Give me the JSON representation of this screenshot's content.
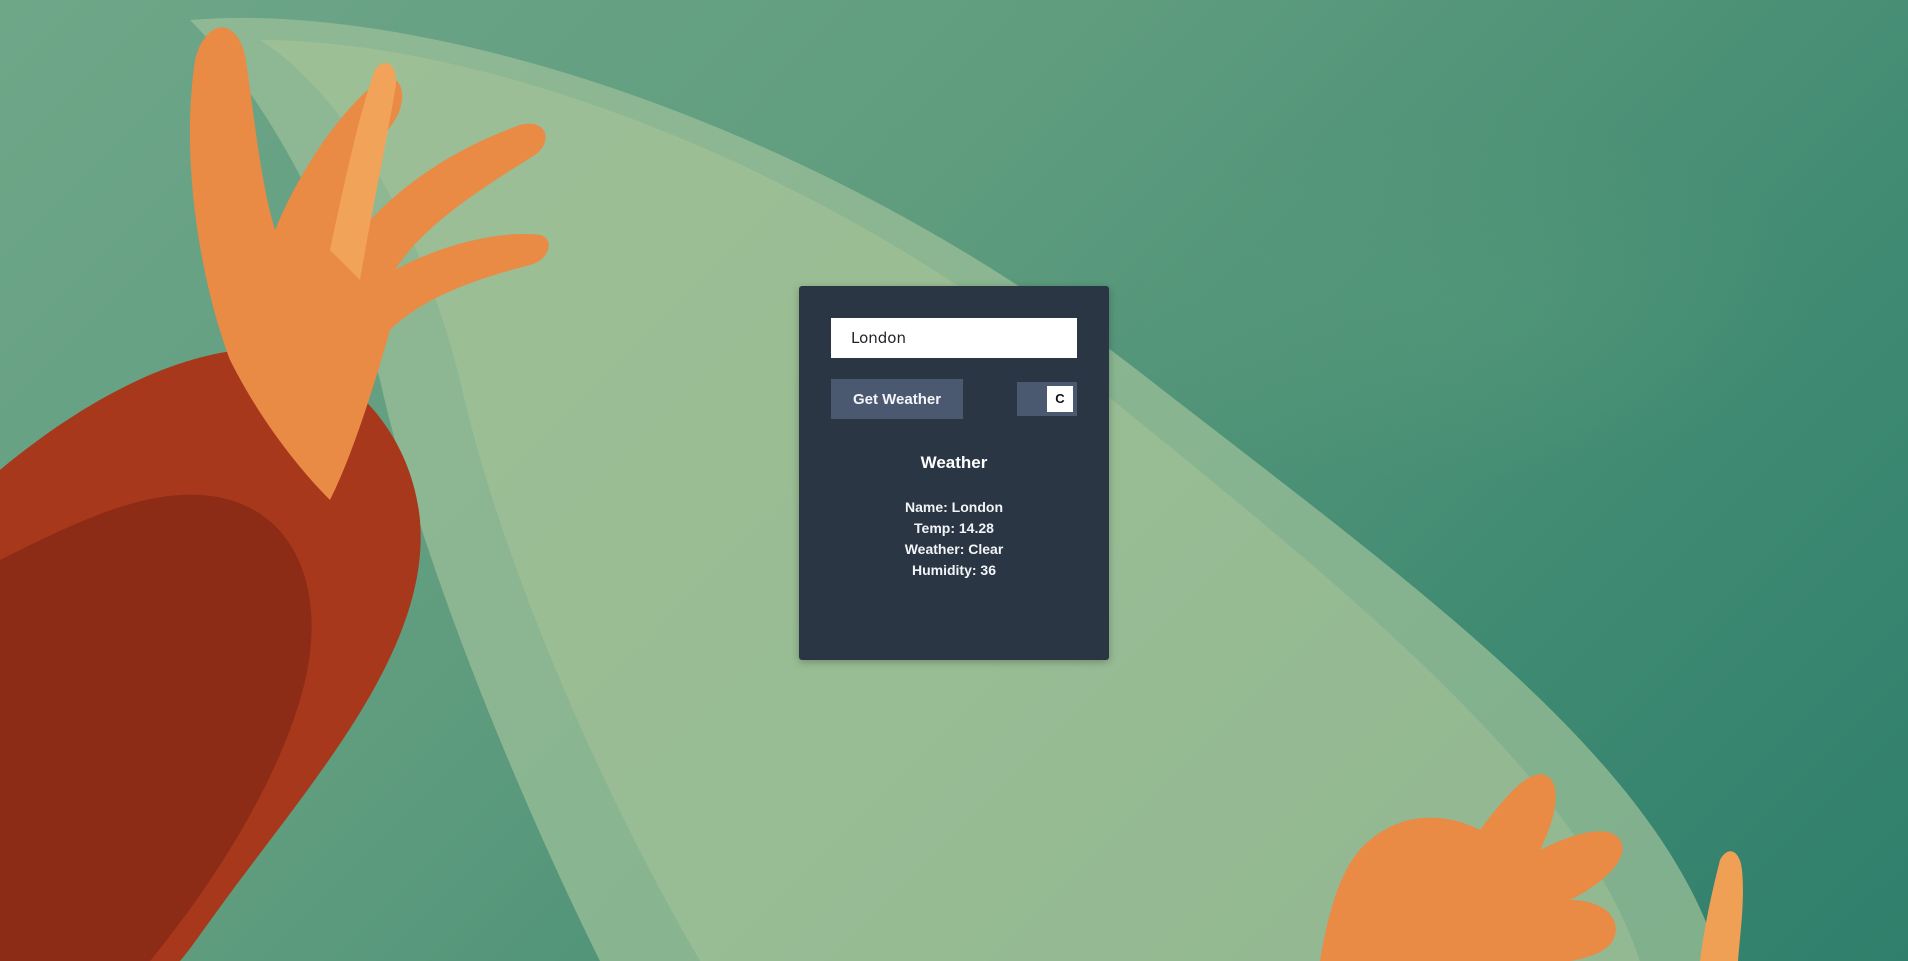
{
  "search": {
    "value": "London"
  },
  "controls": {
    "get_weather_label": "Get Weather",
    "unit_label": "C"
  },
  "weather": {
    "title": "Weather",
    "name_line": "Name: London",
    "temp_line": "Temp: 14.28",
    "condition_line": "Weather: Clear",
    "humidity_line": "Humidity: 36"
  },
  "colors": {
    "card_background": "#2a3644",
    "button_background": "#4a5870",
    "page_background": "#5f9c7e",
    "accent_orange": "#e8743a"
  },
  "icons": {
    "background": "hands-holding-ice-sheet-photo"
  }
}
